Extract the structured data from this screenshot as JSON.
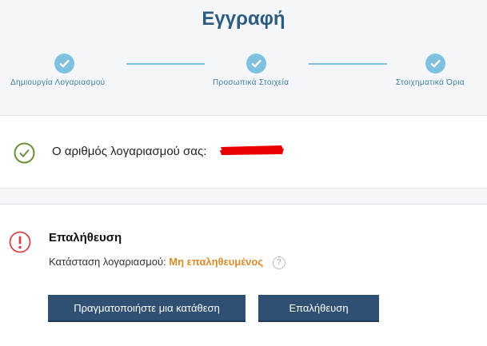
{
  "header": {
    "title": "Εγγραφή",
    "steps": [
      {
        "label": "Δημιουργία Λογαριασμού",
        "status": "completed"
      },
      {
        "label": "Προσωπικά Στοιχεία",
        "status": "completed"
      },
      {
        "label": "Στοιχηματικά Όρια",
        "status": "completed"
      }
    ]
  },
  "account": {
    "label": "Ο αριθμός λογαριασμού σας:",
    "value_redacted": true
  },
  "verification": {
    "title": "Επαλήθευση",
    "status_label": "Κατάσταση λογαριασμού:",
    "status_value": "Μη επαληθευμένος",
    "help_glyph": "?"
  },
  "actions": {
    "deposit_label": "Πραγματοποιήστε μια κατάθεση",
    "verify_label": "Επαλήθευση"
  },
  "colors": {
    "accent": "#7fc1de",
    "title": "#2b5b7e",
    "button": "#2f4f73",
    "status_warning": "#d98c2b",
    "ok_green": "#6f8f3a",
    "alert_red": "#d64545"
  }
}
